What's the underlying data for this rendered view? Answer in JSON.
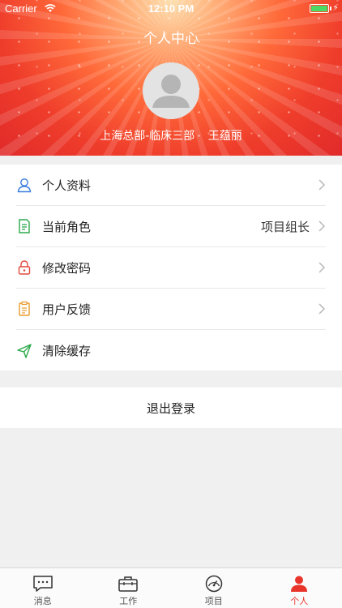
{
  "status_bar": {
    "carrier": "Carrier",
    "time": "12:10 PM",
    "battery_color": "#4cd964"
  },
  "header": {
    "title": "个人中心",
    "department": "上海总部-临床三部",
    "user_name": "王蕴丽",
    "gradient_colors": [
      "#fde0b0",
      "#ff6a3a",
      "#e02a2a"
    ]
  },
  "menu": {
    "items": [
      {
        "label": "个人资料",
        "icon": "user-outline-icon",
        "value": "",
        "chevron": true
      },
      {
        "label": "当前角色",
        "icon": "document-role-icon",
        "value": "项目组长",
        "chevron": true
      },
      {
        "label": "修改密码",
        "icon": "lock-icon",
        "value": "",
        "chevron": true
      },
      {
        "label": "用户反馈",
        "icon": "clipboard-icon",
        "value": "",
        "chevron": true
      },
      {
        "label": "清除缓存",
        "icon": "send-icon",
        "value": "",
        "chevron": false
      }
    ]
  },
  "logout_label": "退出登录",
  "tabbar": {
    "active_color": "#e8342b",
    "tabs": [
      {
        "label": "消息",
        "icon": "message-icon"
      },
      {
        "label": "工作",
        "icon": "briefcase-icon"
      },
      {
        "label": "项目",
        "icon": "dashboard-icon"
      },
      {
        "label": "个人",
        "icon": "person-icon",
        "active": true
      }
    ]
  }
}
